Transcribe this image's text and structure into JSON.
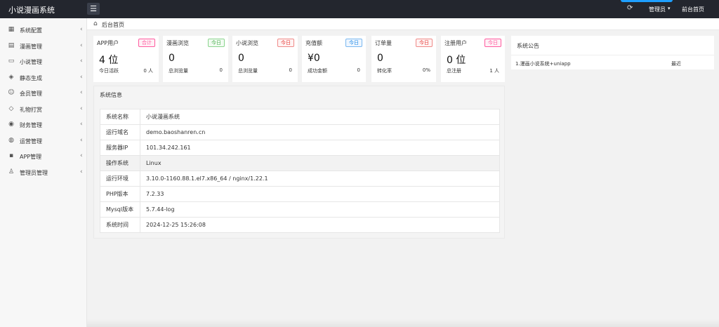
{
  "header": {
    "brand": "小说漫画系统",
    "menu_toggle_glyph": "☰",
    "refresh_glyph": "⟳",
    "admin_label": "管理员",
    "admin_caret": "▾",
    "home_label": "前台首页"
  },
  "sidebar": {
    "items": [
      {
        "label": "系统配置",
        "icon": "grid-icon",
        "glyph": "▦"
      },
      {
        "label": "漫画管理",
        "icon": "comic-icon",
        "glyph": "▤"
      },
      {
        "label": "小说管理",
        "icon": "book-icon",
        "glyph": "▭"
      },
      {
        "label": "静态生成",
        "icon": "layers-icon",
        "glyph": "◈"
      },
      {
        "label": "会员管理",
        "icon": "user-icon",
        "glyph": "☺"
      },
      {
        "label": "礼物打赏",
        "icon": "gift-icon",
        "glyph": "◇"
      },
      {
        "label": "财务管理",
        "icon": "finance-icon",
        "glyph": "◉"
      },
      {
        "label": "运营管理",
        "icon": "globe-icon",
        "glyph": "◍"
      },
      {
        "label": "APP管理",
        "icon": "windows-icon",
        "glyph": "▪"
      },
      {
        "label": "管理员管理",
        "icon": "admin-icon",
        "glyph": "♙"
      }
    ],
    "caret_glyph": "‹"
  },
  "breadcrumb": {
    "home_glyph": "⌂",
    "text": "后台首页"
  },
  "cards": [
    {
      "title": "APP用户",
      "badge": "合计",
      "badge_style": "pink",
      "value": "4 位",
      "sub_label": "今日活跃",
      "sub_value": "0 人"
    },
    {
      "title": "漫画浏览",
      "badge": "今日",
      "badge_style": "green",
      "value": "0",
      "sub_label": "总浏览量",
      "sub_value": "0"
    },
    {
      "title": "小说浏览",
      "badge": "今日",
      "badge_style": "red",
      "value": "0",
      "sub_label": "总浏览量",
      "sub_value": "0"
    },
    {
      "title": "充值额",
      "badge": "今日",
      "badge_style": "blue",
      "value": "¥0",
      "sub_label": "成功金额",
      "sub_value": "0"
    },
    {
      "title": "订单量",
      "badge": "今日",
      "badge_style": "red",
      "value": "0",
      "sub_label": "转化率",
      "sub_value": "0%"
    },
    {
      "title": "注册用户",
      "badge": "今日",
      "badge_style": "pink",
      "value": "0 位",
      "sub_label": "总注册",
      "sub_value": "1 人"
    }
  ],
  "notice": {
    "title": "系统公告",
    "items": [
      {
        "text": "1.漫画小说系统+uniapp",
        "date": "最近"
      }
    ]
  },
  "sysinfo": {
    "title": "系统信息",
    "rows": [
      {
        "key": "系统名称",
        "value": "小说漫画系统"
      },
      {
        "key": "运行域名",
        "value": "demo.baoshanren.cn"
      },
      {
        "key": "服务器IP",
        "value": "101.34.242.161"
      },
      {
        "key": "操作系统",
        "value": "Linux"
      },
      {
        "key": "运行环境",
        "value": "3.10.0-1160.88.1.el7.x86_64 / nginx/1.22.1"
      },
      {
        "key": "PHP版本",
        "value": "7.2.33"
      },
      {
        "key": "Mysql版本",
        "value": "5.7.44-log"
      },
      {
        "key": "系统时间",
        "value": "2024-12-25 15:26:08"
      }
    ]
  },
  "colors": {
    "topbar": "#23262e",
    "accent": "#1e9fff",
    "badge_pink": "#ff5b9f",
    "badge_green": "#4caf50",
    "badge_red": "#e53935",
    "badge_blue": "#1e88e5"
  }
}
